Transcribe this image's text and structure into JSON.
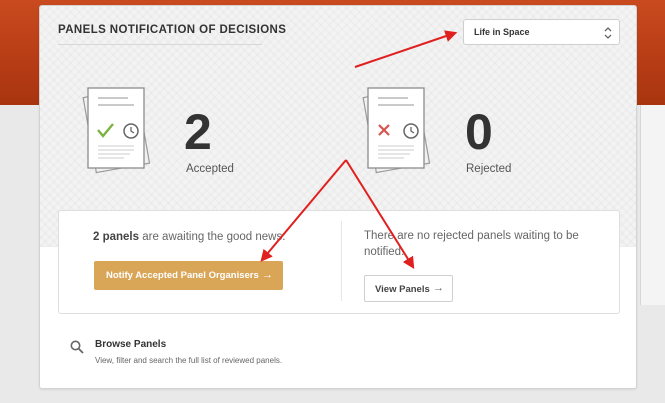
{
  "header": {
    "title": "PANELS NOTIFICATION OF DECISIONS",
    "event_select": {
      "value": "Life in Space"
    }
  },
  "stats": {
    "accepted": {
      "count": "2",
      "label": "Accepted"
    },
    "rejected": {
      "count": "0",
      "label": "Rejected"
    }
  },
  "actions": {
    "accepted_msg_count": "2 panels",
    "accepted_msg_rest": " are awaiting the good news.",
    "notify_button": "Notify Accepted Panel Organisers",
    "rejected_msg": "There are no rejected panels waiting to be notified.",
    "view_button": "View Panels"
  },
  "browse": {
    "title": "Browse Panels",
    "description": "View, filter and search the full list of reviewed panels."
  },
  "icons": {
    "arrow": "→",
    "accepted": "check-icon",
    "rejected": "cross-icon",
    "clock": "clock-icon",
    "search": "search-icon"
  },
  "colors": {
    "accent_button": "#d9a658",
    "brand_header": "#b83d16",
    "annotation_arrow": "#e0201f",
    "check": "#7cb342",
    "cross": "#d9534f"
  }
}
